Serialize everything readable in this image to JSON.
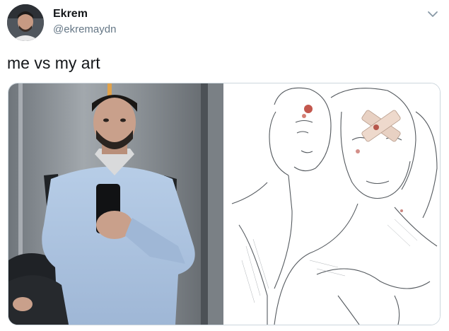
{
  "author": {
    "display_name": "Ekrem",
    "handle": "@ekremaydn"
  },
  "tweet": {
    "text": "me vs my art"
  },
  "icons": {
    "more": "chevron-down-icon"
  },
  "colors": {
    "handle_gray": "#657786",
    "text_dark": "#14171a",
    "border": "#ccd6dd",
    "shirt_blue": "#a9c2e0",
    "elevator_steel": "#8a9096"
  }
}
